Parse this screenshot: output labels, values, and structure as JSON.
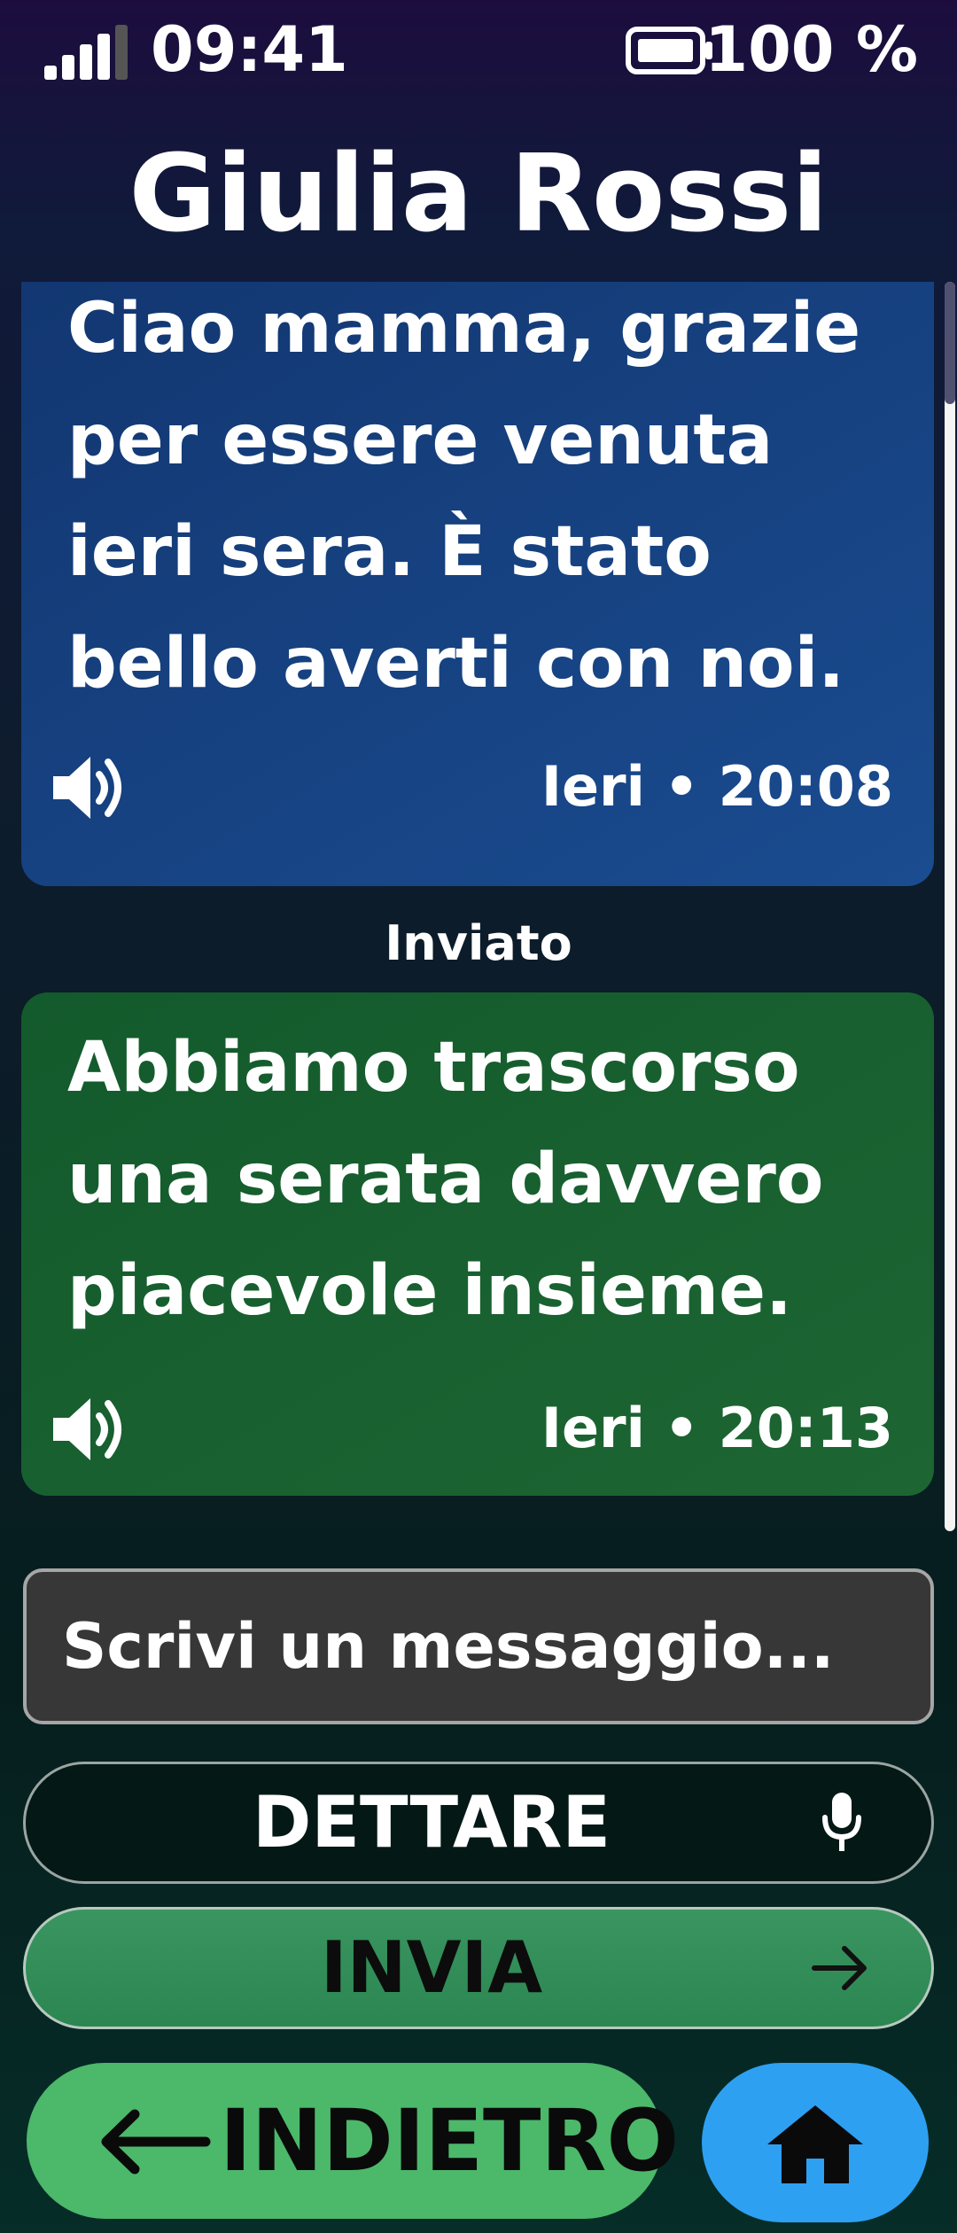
{
  "status_bar": {
    "time": "09:41",
    "battery_text": "100 %",
    "signal_icon": "signal-bars-icon",
    "battery_icon": "battery-icon"
  },
  "header": {
    "title": "Giulia Rossi"
  },
  "messages": [
    {
      "direction": "received",
      "text": "Ciao mamma, grazie per essere venuta ieri sera. È stato bello averti con noi.",
      "timestamp": "Ieri • 20:08",
      "icon": "speaker-icon",
      "color": "#1a4c90"
    },
    {
      "direction": "sent",
      "status": "Inviato",
      "text": "Abbiamo trascorso una serata davvero piacevole insieme.",
      "timestamp": "Ieri • 20:13",
      "icon": "speaker-icon",
      "color": "#1d6633"
    }
  ],
  "composer": {
    "value": "",
    "placeholder": "Scrivi un messaggio..."
  },
  "actions": {
    "dictate_label": "DETTARE",
    "dictate_icon": "microphone-icon",
    "send_label": "INVIA",
    "send_icon": "arrow-right-icon",
    "send_color": "#2b8652",
    "back_label": "INDIETRO",
    "back_icon": "arrow-left-icon",
    "back_color": "#4cb86a",
    "home_icon": "home-icon",
    "home_color": "#2ea0f2"
  }
}
